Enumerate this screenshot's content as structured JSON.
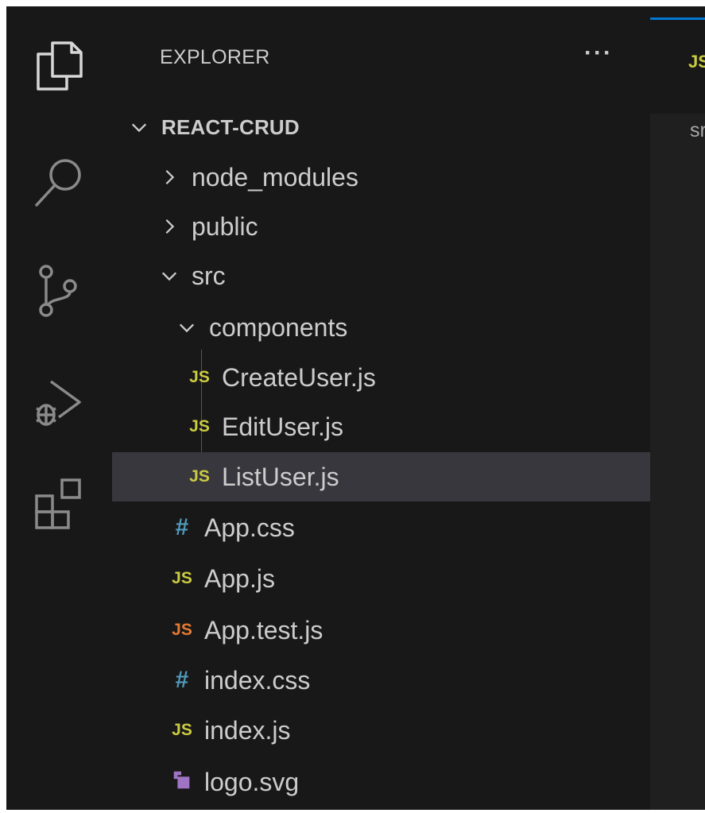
{
  "sidebar": {
    "header": "EXPLORER",
    "more": "···",
    "root": "REACT-CRUD",
    "items": [
      {
        "label": "node_modules",
        "type": "folder",
        "expanded": false
      },
      {
        "label": "public",
        "type": "folder",
        "expanded": false
      },
      {
        "label": "src",
        "type": "folder",
        "expanded": true
      },
      {
        "label": "components",
        "type": "folder",
        "expanded": true
      },
      {
        "label": "CreateUser.js",
        "type": "file",
        "icon": "JS",
        "icon_color": "#cbcb41"
      },
      {
        "label": "EditUser.js",
        "type": "file",
        "icon": "JS",
        "icon_color": "#cbcb41"
      },
      {
        "label": "ListUser.js",
        "type": "file",
        "icon": "JS",
        "icon_color": "#cbcb41",
        "selected": true
      },
      {
        "label": "App.css",
        "type": "file",
        "icon": "#",
        "icon_color": "#519aba"
      },
      {
        "label": "App.js",
        "type": "file",
        "icon": "JS",
        "icon_color": "#cbcb41"
      },
      {
        "label": "App.test.js",
        "type": "file",
        "icon": "JS",
        "icon_color": "#e37933"
      },
      {
        "label": "index.css",
        "type": "file",
        "icon": "#",
        "icon_color": "#519aba"
      },
      {
        "label": "index.js",
        "type": "file",
        "icon": "JS",
        "icon_color": "#cbcb41"
      },
      {
        "label": "logo.svg",
        "type": "file",
        "icon": "svg-icon",
        "icon_color": "#a074c4"
      }
    ]
  },
  "editor": {
    "tab_icon": "JS",
    "breadcrumb": "sr"
  },
  "colors": {
    "background": "#181818",
    "selected_row": "#37373d",
    "accent": "#0078d4",
    "text": "#cccccc"
  }
}
